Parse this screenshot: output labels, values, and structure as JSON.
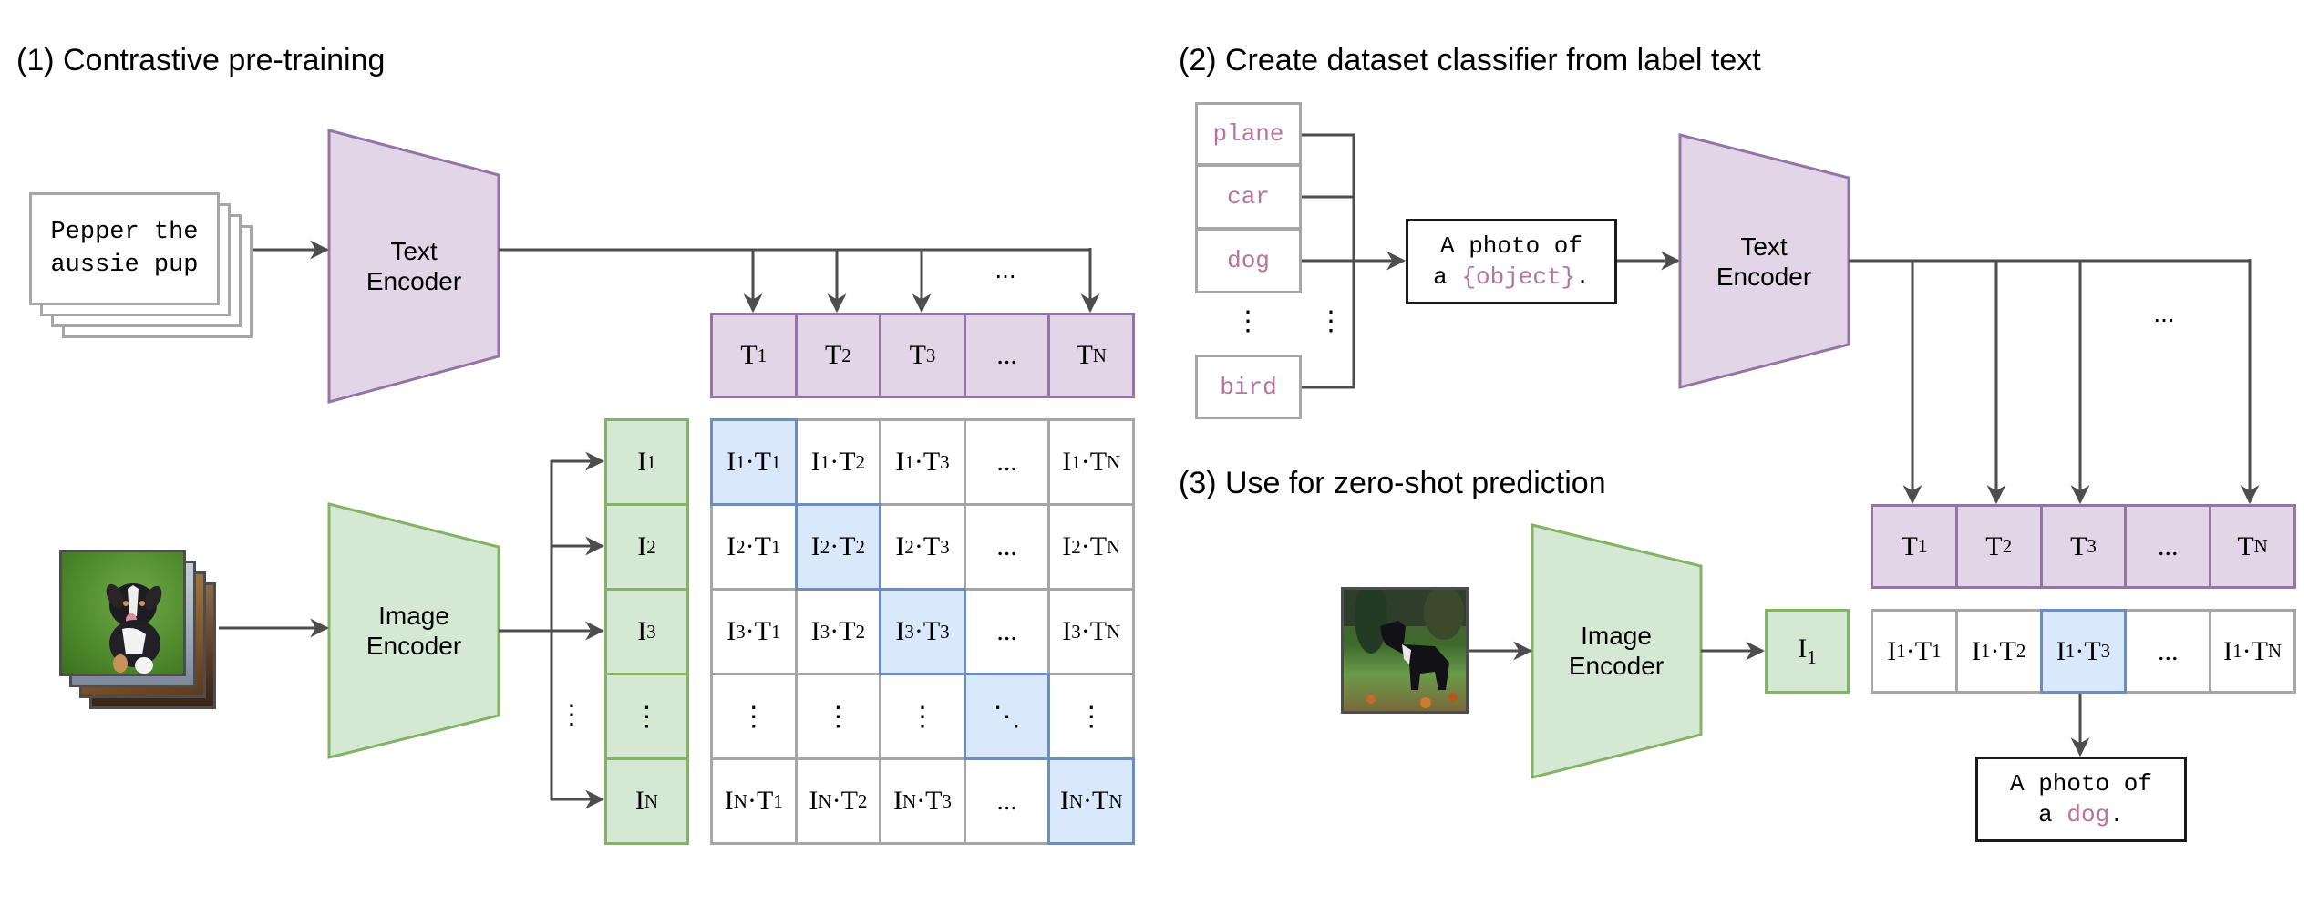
{
  "sections": {
    "pretraining": {
      "title": "(1) Contrastive pre-training",
      "input_text_line1": "Pepper the",
      "input_text_line2": "aussie pup",
      "text_encoder_label_line1": "Text",
      "text_encoder_label_line2": "Encoder",
      "image_encoder_label_line1": "Image",
      "image_encoder_label_line2": "Encoder",
      "input_image": "puppy-photo-stack",
      "text_embeddings": [
        "T1",
        "T2",
        "T3",
        "...",
        "TN"
      ],
      "image_embeddings": [
        "I1",
        "I2",
        "I3",
        "⋮",
        "IN"
      ],
      "ellipsis": "...",
      "vertical_ellipsis": "⋮",
      "matrix_rows": [
        [
          "I1·T1",
          "I1·T2",
          "I1·T3",
          "...",
          "I1·TN"
        ],
        [
          "I2·T1",
          "I2·T2",
          "I2·T3",
          "...",
          "I2·TN"
        ],
        [
          "I3·T1",
          "I3·T2",
          "I3·T3",
          "...",
          "I3·TN"
        ],
        [
          "⋮",
          "⋮",
          "⋮",
          "⋱",
          "⋮"
        ],
        [
          "IN·T1",
          "IN·T2",
          "IN·T3",
          "...",
          "IN·TN"
        ]
      ],
      "highlight": "diagonal"
    },
    "classifier": {
      "title": "(2) Create dataset classifier from label text",
      "labels": [
        "plane",
        "car",
        "dog",
        "bird"
      ],
      "vertical_ellipsis": "⋮",
      "template_line1": "A photo of",
      "template_prefix": "a ",
      "template_placeholder": "{object}",
      "template_suffix": ".",
      "text_encoder_label_line1": "Text",
      "text_encoder_label_line2": "Encoder",
      "ellipsis": "..."
    },
    "zeroshot": {
      "title": "(3) Use for zero-shot prediction",
      "input_image": "dog-photo",
      "image_encoder_label_line1": "Image",
      "image_encoder_label_line2": "Encoder",
      "image_embedding": "I1",
      "text_embeddings": [
        "T1",
        "T2",
        "T3",
        "...",
        "TN"
      ],
      "scores": [
        "I1·T1",
        "I1·T2",
        "I1·T3",
        "...",
        "I1·TN"
      ],
      "selected_index": 2,
      "result_line1": "A photo of",
      "result_prefix": "a ",
      "result_class": "dog",
      "result_suffix": "."
    }
  },
  "colors": {
    "text_encoder_fill": "#e1d5e7",
    "text_encoder_border": "#9673a6",
    "image_encoder_fill": "#d5e8d4",
    "image_encoder_border": "#82b366",
    "highlight_fill": "#dae8fc",
    "highlight_border": "#6c8ebf",
    "label_text": "#b5739d",
    "arrow": "#4d4d4d"
  }
}
